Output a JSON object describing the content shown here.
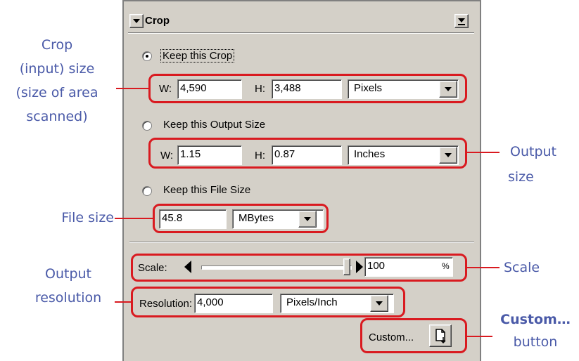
{
  "panel": {
    "title": "Crop",
    "keep_crop_label": "Keep this Crop",
    "keep_output_label": "Keep this Output Size",
    "keep_file_label": "Keep this File Size",
    "crop_row": {
      "w_label": "W:",
      "w_value": "4,590",
      "h_label": "H:",
      "h_value": "3,488",
      "unit": "Pixels"
    },
    "output_row": {
      "w_label": "W:",
      "w_value": "1.15",
      "h_label": "H:",
      "h_value": "0.87",
      "unit": "Inches"
    },
    "file_row": {
      "value": "45.8",
      "unit": "MBytes"
    },
    "scale": {
      "label": "Scale:",
      "value": "100",
      "percent": "%",
      "slider_fraction": 1.0
    },
    "resolution": {
      "label": "Resolution:",
      "value": "4,000",
      "unit": "Pixels/Inch"
    },
    "custom_label": "Custom...",
    "selected_radio": "keep_crop"
  },
  "annotations": {
    "crop_size": [
      "Crop",
      "(input) size",
      "(size of area",
      "scanned)"
    ],
    "output_size": [
      "Output",
      "size"
    ],
    "file_size": "File size",
    "scale": "Scale",
    "output_resolution": [
      "Output",
      "resolution"
    ],
    "custom_button": [
      "Custom…",
      "button"
    ]
  },
  "colors": {
    "annotation_text": "#4a5aa8",
    "highlight": "#d91a20",
    "panel_bg": "#d4d0c8"
  },
  "icons": {
    "custom_button_icon": "document-arrow-icon",
    "panel_menu": "chevron-down-icon"
  }
}
